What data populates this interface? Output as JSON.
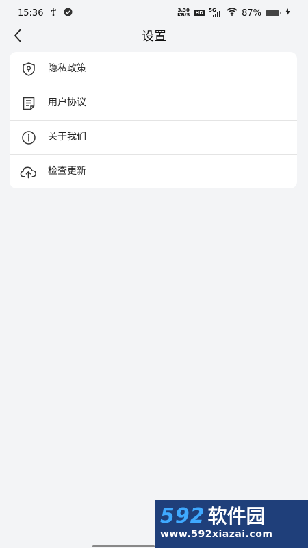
{
  "status_bar": {
    "time": "15:36",
    "net_speed_value": "3.30",
    "net_speed_unit": "KB/S",
    "hd": "HD",
    "network": "5G",
    "battery_percent": "87%",
    "battery_level": 0.87,
    "icons": [
      "usb-icon",
      "check-circle-icon",
      "wifi-icon",
      "battery-icon",
      "charging-icon"
    ]
  },
  "header": {
    "title": "设置",
    "back_icon": "chevron-left-icon"
  },
  "settings": {
    "items": [
      {
        "label": "隐私政策",
        "icon": "shield-lock-icon"
      },
      {
        "label": "用户协议",
        "icon": "document-icon"
      },
      {
        "label": "关于我们",
        "icon": "info-icon"
      },
      {
        "label": "检查更新",
        "icon": "cloud-upload-icon"
      }
    ]
  },
  "watermark": {
    "logo_number": "592",
    "logo_text": "软件园",
    "url": "www.592xiazai.com"
  },
  "colors": {
    "background": "#f3f4f6",
    "card": "#ffffff",
    "divider": "#e4e4e4",
    "watermark_bg": "#1f3f7a",
    "watermark_accent": "#3fa9ff"
  }
}
